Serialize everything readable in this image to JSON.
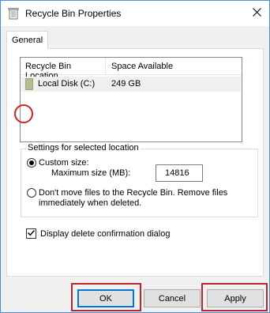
{
  "window": {
    "title": "Recycle Bin Properties"
  },
  "tabs": [
    {
      "label": "General"
    }
  ],
  "locations": {
    "columns": [
      "Recycle Bin Location",
      "Space Available"
    ],
    "rows": [
      {
        "name": "Local Disk (C:)",
        "space": "249 GB"
      }
    ]
  },
  "settings": {
    "group_label": "Settings for selected location",
    "custom_size_label": "Custom size:",
    "max_size_label": "Maximum size (MB):",
    "max_size_value": "14816",
    "dont_move_label_line1": "Don't move files to the Recycle Bin. Remove files",
    "dont_move_label_line2": "immediately when deleted.",
    "selected_option": "custom_size"
  },
  "confirm": {
    "label": "Display delete confirmation dialog",
    "checked": true
  },
  "buttons": {
    "ok": "OK",
    "cancel": "Cancel",
    "apply": "Apply"
  },
  "colors": {
    "highlight_red": "#d61f1f",
    "frame_red": "#b8272f",
    "accent_blue": "#0078d7",
    "window_border": "#4a90d9"
  }
}
